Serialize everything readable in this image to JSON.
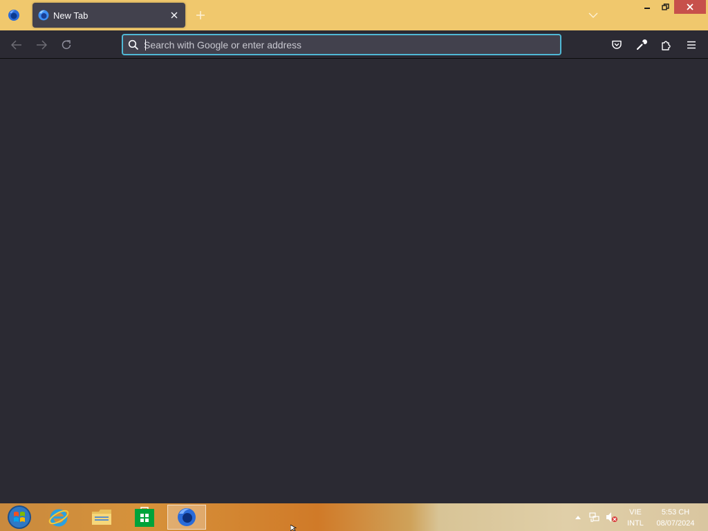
{
  "browser": {
    "tab": {
      "title": "New Tab"
    },
    "urlbar": {
      "placeholder": "Search with Google or enter address"
    }
  },
  "taskbar": {
    "language": {
      "line1": "VIE",
      "line2": "INTL"
    },
    "clock": {
      "time": "5:53 CH",
      "date": "08/07/2024"
    }
  },
  "colors": {
    "titlebar": "#f0c86d",
    "toolbar": "#2b2a33",
    "tab_active": "#42414d",
    "urlbar_focus": "#50b9d6",
    "close_button": "#c7504b"
  }
}
